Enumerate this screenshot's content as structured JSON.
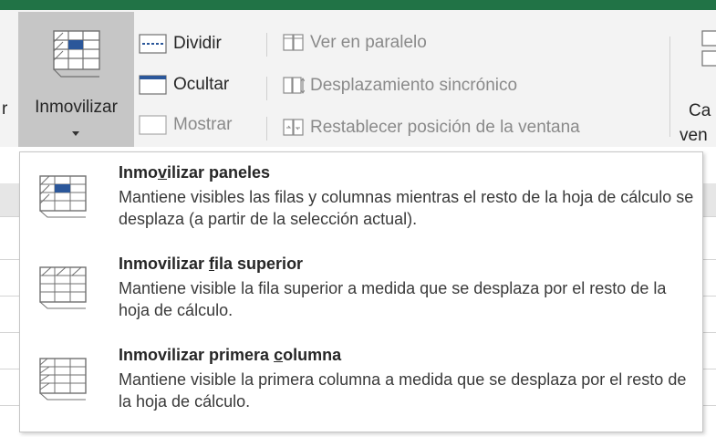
{
  "ribbon": {
    "cut_left_text": "r",
    "freeze_button": {
      "label": "Inmovilizar",
      "caret": "▾"
    },
    "commands": {
      "split": "Dividir",
      "hide": "Ocultar",
      "unhide": "Mostrar",
      "view_side_by_side": "Ver en paralelo",
      "sync_scroll": "Desplazamiento sincrónico",
      "reset_window": "Restablecer posición de la ventana"
    },
    "cut_right": {
      "line1": "Ca",
      "line2": "ven"
    }
  },
  "menu": {
    "items": [
      {
        "title_pre": "Inmo",
        "title_key": "v",
        "title_post": "ilizar paneles",
        "description": "Mantiene visibles las filas y columnas mientras el resto de la hoja de cálculo se desplaza (a partir de la selección actual).",
        "icon": "freeze-panes-icon"
      },
      {
        "title_pre": "Inmovilizar ",
        "title_key": "f",
        "title_post": "ila superior",
        "description": "Mantiene visible la fila superior a medida que se desplaza por el resto de la hoja de cálculo.",
        "icon": "freeze-top-row-icon"
      },
      {
        "title_pre": "Inmovilizar primera ",
        "title_key": "c",
        "title_post": "olumna",
        "description": "Mantiene visible la primera columna a medida que se desplaza por el resto de la hoja de cálculo.",
        "icon": "freeze-first-column-icon"
      }
    ]
  },
  "colors": {
    "excel_green": "#217346",
    "ribbon_bg": "#f3f3f3",
    "pressed_button": "#c6c6c6",
    "accent_blue": "#2b579a"
  }
}
